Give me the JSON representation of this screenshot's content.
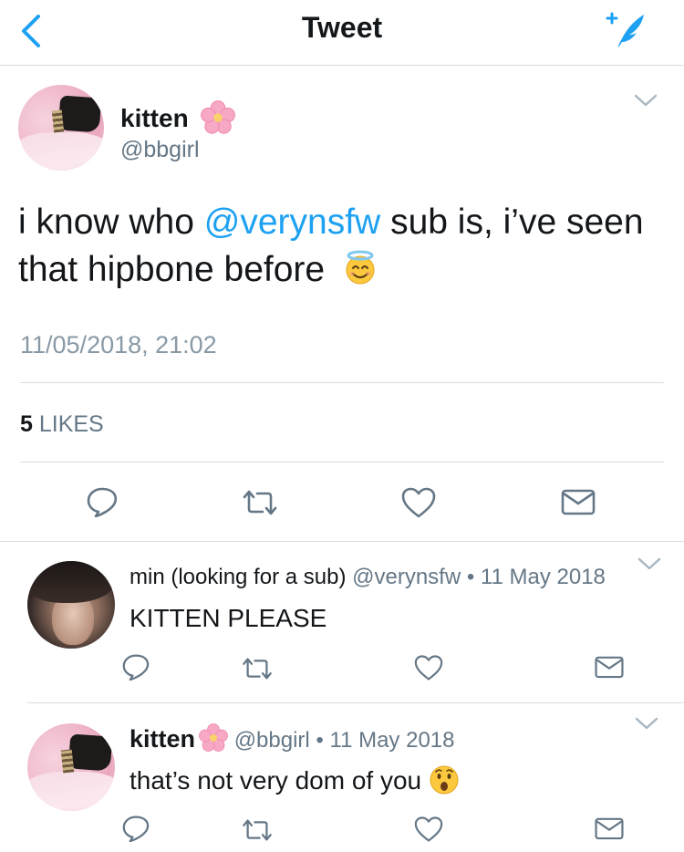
{
  "nav": {
    "title": "Tweet",
    "back_icon": "chevron-left-icon",
    "compose_icon": "compose-tweet-icon",
    "accent": "#1da1f2"
  },
  "tweet": {
    "author_name": "kitten",
    "author_handle": "@bbgirl",
    "name_emoji": "cherry-blossom",
    "text_before": "i know who ",
    "mention": "@verynsfw",
    "text_after": " sub is, i’ve seen that hipbone before",
    "text_emoji": "smiling-face-with-halo",
    "timestamp": "11/05/2018, 21:02",
    "likes_count": "5",
    "likes_label": "LIKES"
  },
  "replies": [
    {
      "name": "min (looking for a sub)",
      "handle": "@verynsfw",
      "separator": "•",
      "date": "11 May 2018",
      "text": "KITTEN PLEASE"
    },
    {
      "name": "kitten",
      "name_emoji": "cherry-blossom",
      "handle": "@bbgirl",
      "separator": "•",
      "date": "11 May 2018",
      "text": "that’s not very dom of you",
      "text_emoji": "hushed-face"
    }
  ],
  "colors": {
    "text": "#14171a",
    "secondary": "#657786",
    "timestamp": "#8899a6",
    "link": "#1da1f2",
    "divider": "#d8dde1"
  }
}
